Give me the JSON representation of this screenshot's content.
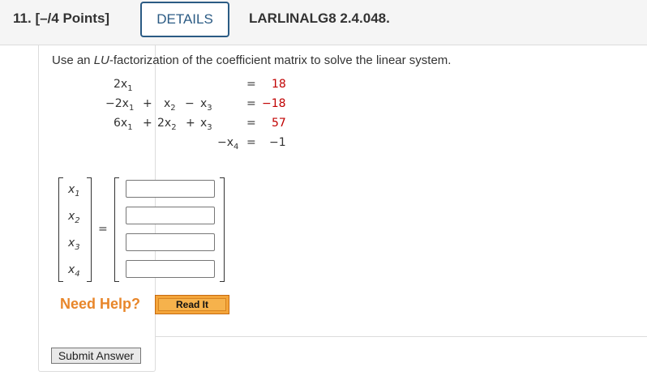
{
  "header": {
    "question_number": "11.",
    "points": "[–/4 Points]",
    "details_label": "DETAILS",
    "question_id": "LARLINALG8 2.4.048."
  },
  "prompt": {
    "text_before": "Use an ",
    "lu": "LU",
    "text_after": "-factorization of the coefficient matrix to solve the linear system."
  },
  "system": {
    "row1": {
      "lhs": "2x",
      "sub1": "1",
      "eq": "=",
      "rhs": "18"
    },
    "row2": {
      "t1": "−2x",
      "s1": "1",
      "p1": "+",
      "t2": "x",
      "s2": "2",
      "m": "−",
      "t3": "x",
      "s3": "3",
      "eq": "=",
      "rhs": "−18"
    },
    "row3": {
      "t1": "6x",
      "s1": "1",
      "p1": "+",
      "t2": "2x",
      "s2": "2",
      "p2": "+",
      "t3": "x",
      "s3": "3",
      "eq": "=",
      "rhs": "57"
    },
    "row4": {
      "t4": "−x",
      "s4": "4",
      "eq": "=",
      "rhs": "−1"
    }
  },
  "vector": {
    "labels": [
      {
        "var": "x",
        "sub": "1"
      },
      {
        "var": "x",
        "sub": "2"
      },
      {
        "var": "x",
        "sub": "3"
      },
      {
        "var": "x",
        "sub": "4"
      }
    ],
    "equals": "=",
    "answers": [
      "",
      "",
      "",
      ""
    ]
  },
  "help": {
    "need_help": "Need Help?",
    "read_it": "Read It"
  },
  "submit_label": "Submit Answer",
  "colors": {
    "accent": "#2b5b84",
    "answer_red": "#c00000",
    "help_orange": "#e8862a"
  }
}
